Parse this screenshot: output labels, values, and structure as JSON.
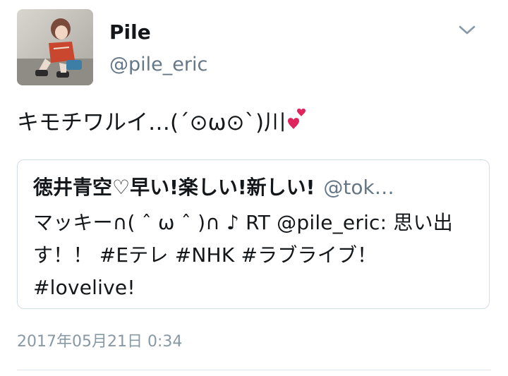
{
  "tweet": {
    "display_name": "Pile",
    "handle": "@pile_eric",
    "text": "キモチワルイ…(´⊙ω⊙`)川",
    "timestamp": "2017年05月21日 0:34"
  },
  "quoted_tweet": {
    "display_name": "徳井青空♡早い!楽しい!新しい!",
    "handle": "@tok…",
    "text": "マッキー∩( ˆ ω ˆ )∩ ♪ RT @pile_eric: 思い出す！！ #Eテレ #NHK #ラブライブ！ #lovelive!"
  },
  "icons": {
    "menu": "chevron-down-icon",
    "emoji": "two-hearts-icon"
  },
  "colors": {
    "text": "#14171a",
    "secondary": "#657786",
    "timestamp": "#8899a6",
    "border": "#d3dde4",
    "heart": "#e0245e"
  }
}
